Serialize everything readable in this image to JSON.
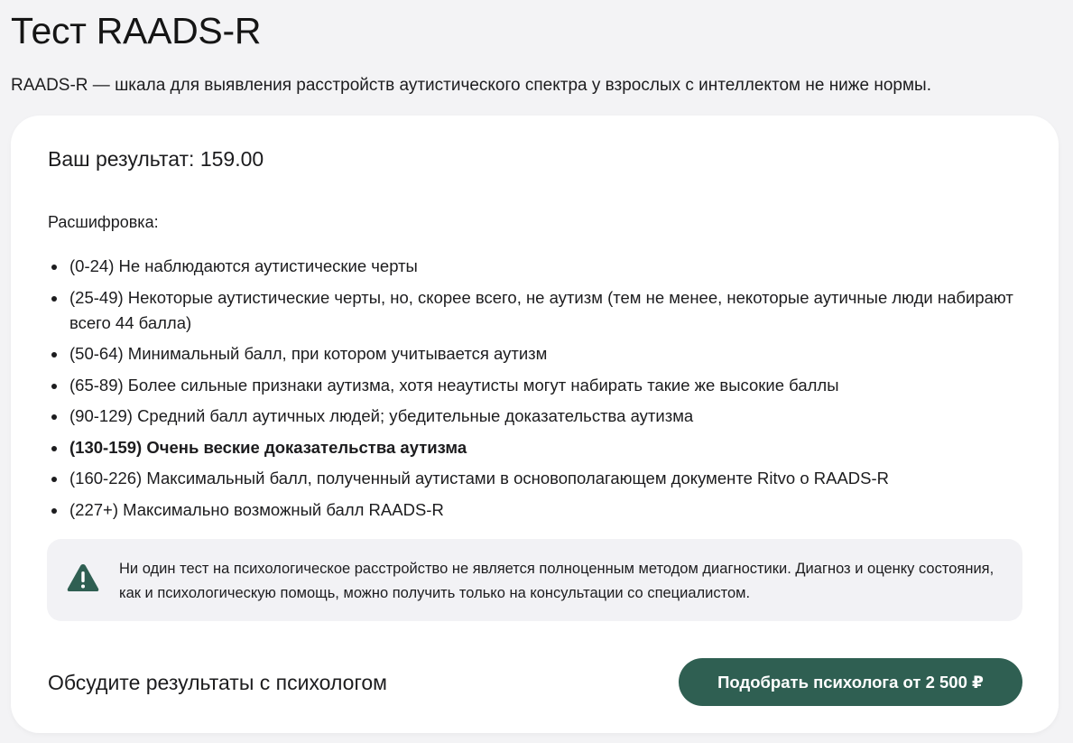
{
  "header": {
    "title": "Тест RAADS-R",
    "subtitle": "RAADS-R — шкала для выявления расстройств аутистического спектра у взрослых с интеллектом не ниже нормы."
  },
  "result": {
    "text": "Ваш результат: 159.00"
  },
  "interpretation": {
    "title": "Расшифровка:",
    "items": [
      "(0-24) Не наблюдаются аутистические черты",
      "(25-49) Некоторые аутистические черты, но, скорее всего, не аутизм (тем не менее, некоторые аутичные люди набирают всего 44 балла)",
      "(50-64) Минимальный балл, при котором учитывается аутизм",
      "(65-89) Более сильные признаки аутизма, хотя неаутисты могут набирать такие же высокие баллы",
      "(90-129) Средний балл аутичных людей; убедительные доказательства аутизма",
      "(130-159) Очень веские доказательства аутизма",
      "(160-226) Максимальный балл, полученный аутистами в основополагающем документе Ritvo о RAADS-R",
      "(227+) Максимально возможный балл RAADS-R"
    ],
    "highlighted_index": 5
  },
  "notice": {
    "icon": "warning-icon",
    "text": "Ни один тест на психологическое расстройство не является полноценным методом диагностики. Диагноз и оценку состояния, как и психологическую помощь, можно получить только на консультации со специалистом."
  },
  "footer": {
    "discuss_label": "Обсудите результаты с психологом",
    "cta_label": "Подобрать психолога от 2 500 ₽"
  },
  "colors": {
    "accent": "#2f5f52",
    "background": "#f3f3f5",
    "card": "#ffffff",
    "notice_bg": "#f2f2f5",
    "text": "#1c1c1e"
  }
}
